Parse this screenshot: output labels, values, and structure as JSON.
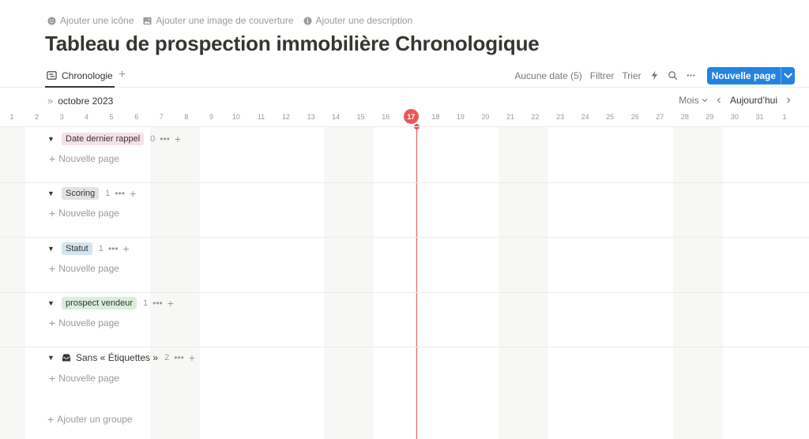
{
  "page_actions": {
    "add_icon": "Ajouter une icône",
    "add_cover": "Ajouter une image de couverture",
    "add_description": "Ajouter une description"
  },
  "page_title": "Tableau de prospection immobilière Chronologique",
  "view_tab": {
    "label": "Chronologie",
    "add_symbol": "+"
  },
  "toolbar": {
    "no_date": "Aucune date (5)",
    "filter": "Filtrer",
    "sort": "Trier",
    "new_page": "Nouvelle page"
  },
  "timeline": {
    "month": "octobre 2023",
    "scale": "Mois",
    "today_button": "Aujourd’hui",
    "days": [
      "1",
      "2",
      "3",
      "4",
      "5",
      "6",
      "7",
      "8",
      "9",
      "10",
      "11",
      "12",
      "13",
      "14",
      "15",
      "16",
      "17",
      "18",
      "19",
      "20",
      "21",
      "22",
      "23",
      "24",
      "25",
      "26",
      "27",
      "28",
      "29",
      "30",
      "31",
      "1"
    ],
    "today_day": "17"
  },
  "groups": [
    {
      "label": "Date dernier rappel",
      "count": "0",
      "color": "#f5e0e9",
      "new_page": "Nouvelle page"
    },
    {
      "label": "Scoring",
      "count": "1",
      "color": "#e3e2e0",
      "new_page": "Nouvelle page"
    },
    {
      "label": "Statut",
      "count": "1",
      "color": "#d3e5ef",
      "new_page": "Nouvelle page"
    },
    {
      "label": "prospect vendeur",
      "count": "1",
      "color": "#dbeddb",
      "new_page": "Nouvelle page"
    },
    {
      "label": "Sans « Étiquettes »",
      "count": "2",
      "color": "transparent",
      "new_page": "Nouvelle page"
    }
  ],
  "add_group": "Ajouter un groupe"
}
